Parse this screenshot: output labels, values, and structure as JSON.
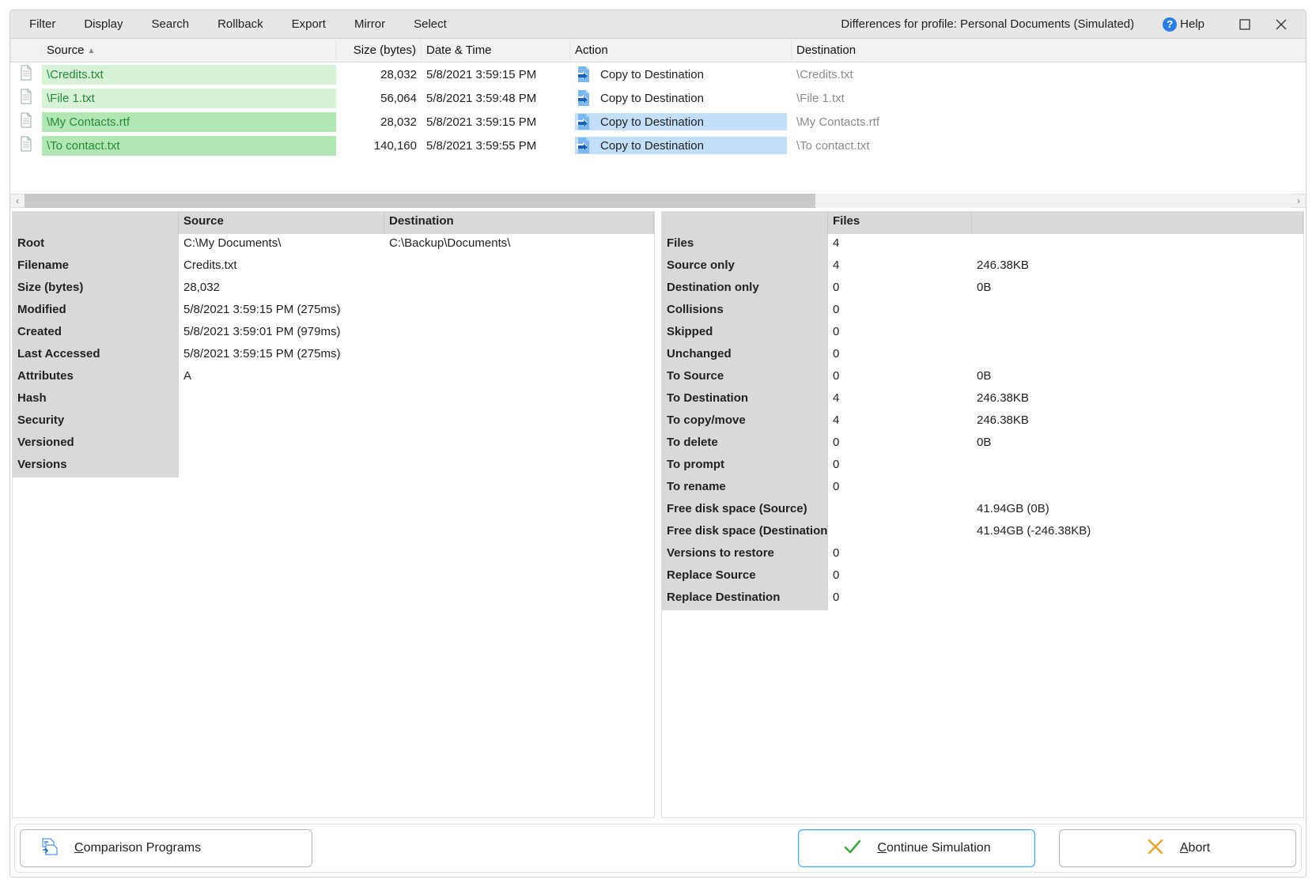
{
  "menu": {
    "filter": "Filter",
    "display": "Display",
    "search": "Search",
    "rollback": "Rollback",
    "export": "Export",
    "mirror": "Mirror",
    "select": "Select"
  },
  "title": "Differences for profile: Personal Documents (Simulated)",
  "help": "Help",
  "columns": {
    "source": "Source",
    "size": "Size (bytes)",
    "date": "Date & Time",
    "action": "Action",
    "dest": "Destination"
  },
  "rows": [
    {
      "src": "\\Credits.txt",
      "size": "28,032",
      "date": "5/8/2021 3:59:15 PM",
      "action": "Copy to Destination",
      "dest": "\\Credits.txt",
      "sel": false
    },
    {
      "src": "\\File 1.txt",
      "size": "56,064",
      "date": "5/8/2021 3:59:48 PM",
      "action": "Copy to Destination",
      "dest": "\\File 1.txt",
      "sel": false
    },
    {
      "src": "\\My Contacts.rtf",
      "size": "28,032",
      "date": "5/8/2021 3:59:15 PM",
      "action": "Copy to Destination",
      "dest": "\\My Contacts.rtf",
      "sel": true
    },
    {
      "src": "\\To contact.txt",
      "size": "140,160",
      "date": "5/8/2021 3:59:55 PM",
      "action": "Copy to Destination",
      "dest": "\\To contact.txt",
      "sel": true
    }
  ],
  "left": {
    "headers": {
      "source": "Source",
      "dest": "Destination"
    },
    "root": {
      "label": "Root",
      "src": "C:\\My Documents\\",
      "dst": "C:\\Backup\\Documents\\"
    },
    "filename": {
      "label": "Filename",
      "val": "Credits.txt"
    },
    "size": {
      "label": "Size (bytes)",
      "val": "28,032"
    },
    "modified": {
      "label": "Modified",
      "val": "5/8/2021 3:59:15 PM (275ms)"
    },
    "created": {
      "label": "Created",
      "val": "5/8/2021 3:59:01 PM (979ms)"
    },
    "accessed": {
      "label": "Last Accessed",
      "val": "5/8/2021 3:59:15 PM (275ms)"
    },
    "attributes": {
      "label": "Attributes",
      "val": "A"
    },
    "hash": {
      "label": "Hash",
      "val": ""
    },
    "security": {
      "label": "Security",
      "val": ""
    },
    "versioned": {
      "label": "Versioned",
      "val": ""
    },
    "versions": {
      "label": "Versions",
      "val": ""
    }
  },
  "right": {
    "header": "Files",
    "stats": [
      {
        "label": "Files",
        "v1": "4",
        "v2": ""
      },
      {
        "label": "Source only",
        "v1": "4",
        "v2": "246.38KB"
      },
      {
        "label": "Destination only",
        "v1": "0",
        "v2": "0B"
      },
      {
        "label": "Collisions",
        "v1": "0",
        "v2": ""
      },
      {
        "label": "Skipped",
        "v1": "0",
        "v2": ""
      },
      {
        "label": "Unchanged",
        "v1": "0",
        "v2": ""
      },
      {
        "label": "To Source",
        "v1": "0",
        "v2": "0B"
      },
      {
        "label": "To Destination",
        "v1": "4",
        "v2": "246.38KB"
      },
      {
        "label": "To copy/move",
        "v1": "4",
        "v2": "246.38KB"
      },
      {
        "label": "To delete",
        "v1": "0",
        "v2": "0B"
      },
      {
        "label": "To prompt",
        "v1": "0",
        "v2": ""
      },
      {
        "label": "To rename",
        "v1": "0",
        "v2": ""
      },
      {
        "label": "Free disk space (Source)",
        "v1": "",
        "v2": "41.94GB (0B)"
      },
      {
        "label": "Free disk space (Destination)",
        "v1": "",
        "v2": "41.94GB (-246.38KB)"
      },
      {
        "label": "Versions to restore",
        "v1": "0",
        "v2": ""
      },
      {
        "label": "Replace Source",
        "v1": "0",
        "v2": ""
      },
      {
        "label": "Replace Destination",
        "v1": "0",
        "v2": ""
      }
    ]
  },
  "footer": {
    "compare": "omparison Programs",
    "compare_acc": "C",
    "continue": "ontinue Simulation",
    "continue_acc": "C",
    "abort": "bort",
    "abort_acc": "A"
  }
}
